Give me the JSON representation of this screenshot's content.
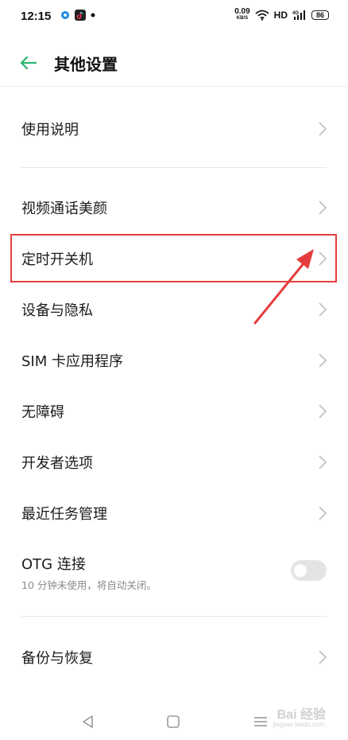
{
  "status_bar": {
    "time": "12:15",
    "net_speed_value": "0.09",
    "net_speed_unit": "KB/S",
    "hd": "HD",
    "signal": "4G",
    "battery": "86"
  },
  "header": {
    "title": "其他设置"
  },
  "menu": {
    "items": [
      {
        "label": "使用说明"
      },
      {
        "label": "视频通话美颜"
      },
      {
        "label": "定时开关机"
      },
      {
        "label": "设备与隐私"
      },
      {
        "label": "SIM 卡应用程序"
      },
      {
        "label": "无障碍"
      },
      {
        "label": "开发者选项"
      },
      {
        "label": "最近任务管理"
      }
    ],
    "otg": {
      "label": "OTG 连接",
      "subtitle": "10 分钟未使用，将自动关闭。",
      "enabled": false
    },
    "backup": {
      "label": "备份与恢复"
    }
  },
  "annotation": {
    "highlight_color": "#e53d3d"
  },
  "accent_color": "#2bb673",
  "watermark": {
    "text": "Bai 经验",
    "sub": "jingyan.baidu.com"
  }
}
